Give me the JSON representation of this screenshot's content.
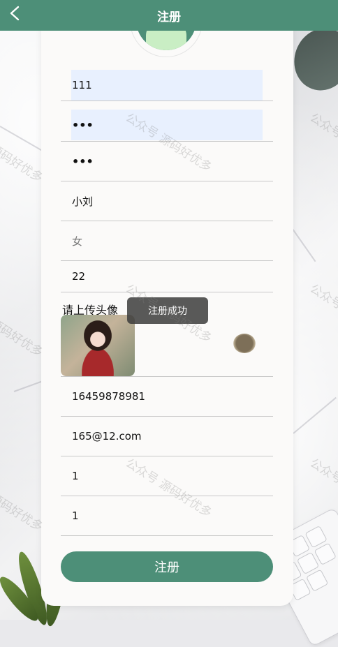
{
  "header": {
    "title": "注册"
  },
  "form": {
    "username": "111",
    "password": "•••",
    "confirm_password": "•••",
    "name": "小刘",
    "gender_placeholder": "女",
    "age": "22",
    "upload_label": "请上传头像",
    "phone": "16459878981",
    "email": "165@12.com",
    "field_a": "1",
    "field_b": "1",
    "submit_label": "注册"
  },
  "toast": {
    "text": "注册成功"
  },
  "watermark": "公众号 源码好优多",
  "colors": {
    "primary": "#4d8f78",
    "autofill": "#e8f0fe",
    "card": "#fbfaf9"
  }
}
